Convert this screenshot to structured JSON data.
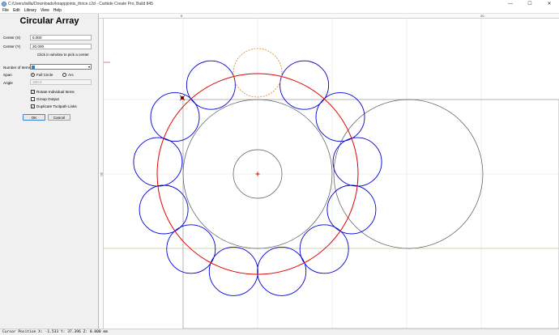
{
  "window": {
    "title": "C:/Users/willa/Downloads/knappjoints_thrice.c2d - Carbide Create Pro, Build 845",
    "controls": {
      "minimize": "—",
      "maximize": "☐",
      "close": "✕"
    }
  },
  "menu": [
    "File",
    "Edit",
    "Library",
    "View",
    "Help"
  ],
  "panel": {
    "title": "Circular Array",
    "center_x_label": "Center (X)",
    "center_x_value": "5.000",
    "center_y_label": "Center (Y)",
    "center_y_value": "20.000",
    "click_hint": "Click in window to pick a center",
    "number_items_label": "Number of Items",
    "number_items_value": "",
    "span_label": "Span",
    "span_full": "Full Circle",
    "span_arc": "Arc",
    "span_selected": "full",
    "angle_label": "Angle",
    "angle_value": "180.0",
    "rotate_label": "Rotate Individual Items",
    "rotate_checked": true,
    "group_label": "Group Output",
    "group_checked": false,
    "duplicate_label": "Duplicate Toolpath Links",
    "duplicate_checked": true,
    "ok_label": "OK",
    "cancel_label": "Cancel"
  },
  "rulers": {
    "top_ticks": [
      "0",
      "20"
    ],
    "left_ticks": [
      "20"
    ]
  },
  "status": {
    "text": "Cursor Position X: -1.533 Y: 37.396 Z: 0.000 mm"
  },
  "colors": {
    "array_circle": "#0000d8",
    "ring": "#e00000",
    "preview": "#e08020",
    "geometry": "#555555",
    "grid": "#e3e3e3",
    "stock_boundary": "#c8c8a0"
  }
}
